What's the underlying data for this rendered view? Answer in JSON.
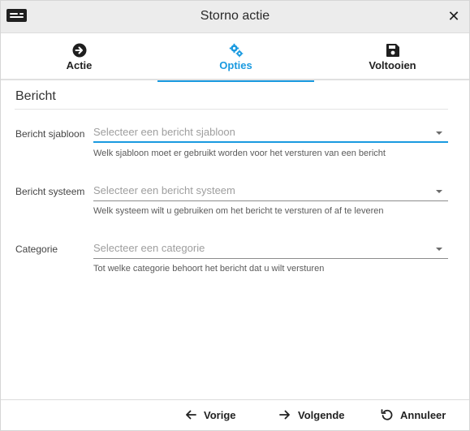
{
  "dialog": {
    "title": "Storno actie",
    "close_icon": "close-icon",
    "app_icon": "card-icon"
  },
  "tabs": [
    {
      "label": "Actie",
      "icon": "arrow-right-circle-icon",
      "active": false
    },
    {
      "label": "Opties",
      "icon": "gears-icon",
      "active": true
    },
    {
      "label": "Voltooien",
      "icon": "save-icon",
      "active": false
    }
  ],
  "colors": {
    "accent": "#1a9ae0",
    "header_bg": "#ececec"
  },
  "section": {
    "title": "Bericht"
  },
  "fields": [
    {
      "label": "Bericht sjabloon",
      "placeholder": "Selecteer een bericht sjabloon",
      "hint": "Welk sjabloon moet er gebruikt worden voor het versturen van een bericht"
    },
    {
      "label": "Bericht systeem",
      "placeholder": "Selecteer een bericht systeem",
      "hint": "Welk systeem wilt u gebruiken om het bericht te versturen of af te leveren"
    },
    {
      "label": "Categorie",
      "placeholder": "Selecteer een categorie",
      "hint": "Tot welke categorie behoort het bericht dat u wilt versturen"
    }
  ],
  "footer": {
    "prev_label": "Vorige",
    "next_label": "Volgende",
    "cancel_label": "Annuleer"
  }
}
